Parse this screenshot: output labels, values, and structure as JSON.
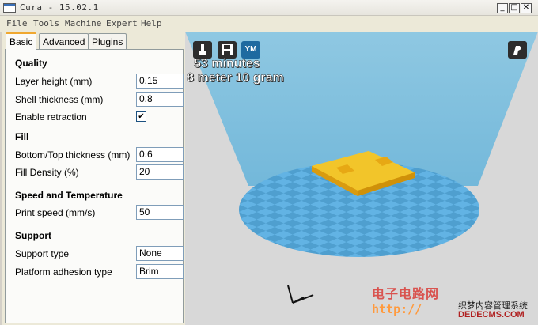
{
  "window": {
    "title": "Cura - 15.02.1",
    "minimize": "_",
    "maximize": "□",
    "close": "✕"
  },
  "menu": [
    "File",
    "Tools",
    "Machine",
    "Expert",
    "Help"
  ],
  "tabs": [
    "Basic",
    "Advanced",
    "Plugins"
  ],
  "active_tab": "Basic",
  "sections": {
    "quality": {
      "title": "Quality",
      "layer_height": {
        "label": "Layer height (mm)",
        "value": "0.15"
      },
      "shell_thickness": {
        "label": "Shell thickness (mm)",
        "value": "0.8"
      },
      "enable_retraction": {
        "label": "Enable retraction",
        "checked": true,
        "mark": "✔"
      }
    },
    "fill": {
      "title": "Fill",
      "bottom_top_thickness": {
        "label": "Bottom/Top thickness (mm)",
        "value": "0.6"
      },
      "fill_density": {
        "label": "Fill Density (%)",
        "value": "20"
      }
    },
    "speed": {
      "title": "Speed and Temperature",
      "print_speed": {
        "label": "Print speed (mm/s)",
        "value": "50"
      }
    },
    "support": {
      "title": "Support",
      "support_type": {
        "label": "Support type",
        "value": "None"
      },
      "platform_adhesion": {
        "label": "Platform adhesion type",
        "value": "Brim"
      }
    }
  },
  "viewport": {
    "print_time": "53 minutes",
    "material_usage": "8 meter 10 gram",
    "buttons": [
      "load-icon",
      "save-icon",
      "youmagine-icon",
      "view-mode-icon"
    ],
    "youmagine_label": "YM"
  },
  "watermark": {
    "line1": "电子电路网",
    "line2": "http://",
    "line3": "织梦内容管理系统",
    "line4": "DEDECMS.COM"
  },
  "colors": {
    "build_volume": "#7fbfdc",
    "platform_light": "#62b3e4",
    "platform_dark": "#4f9fcf",
    "model": "#f2c52a",
    "viewport_bg": "#d8d8d8",
    "tab_accent": "#f0a830"
  }
}
